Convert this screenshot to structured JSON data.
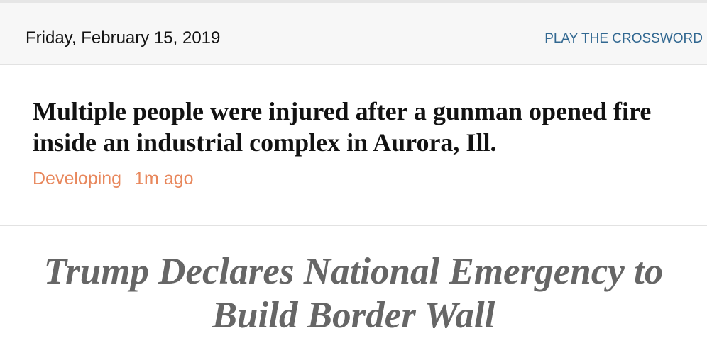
{
  "header": {
    "date": "Friday, February 15, 2019",
    "crossword_link": "PLAY THE CROSSWORD"
  },
  "breaking_news": {
    "headline": "Multiple people were injured after a gunman opened fire inside an industrial complex in Aurora, Ill.",
    "status": "Developing",
    "time_ago": "1m ago"
  },
  "lead_story": {
    "headline_line1": "Trump Declares National Emergency to",
    "headline_line2": "Build Border Wall"
  },
  "colors": {
    "background": "#ffffff",
    "header_background": "#f7f7f7",
    "link_blue": "#326891",
    "developing_orange": "#e8875c",
    "lead_gray": "#666666"
  }
}
